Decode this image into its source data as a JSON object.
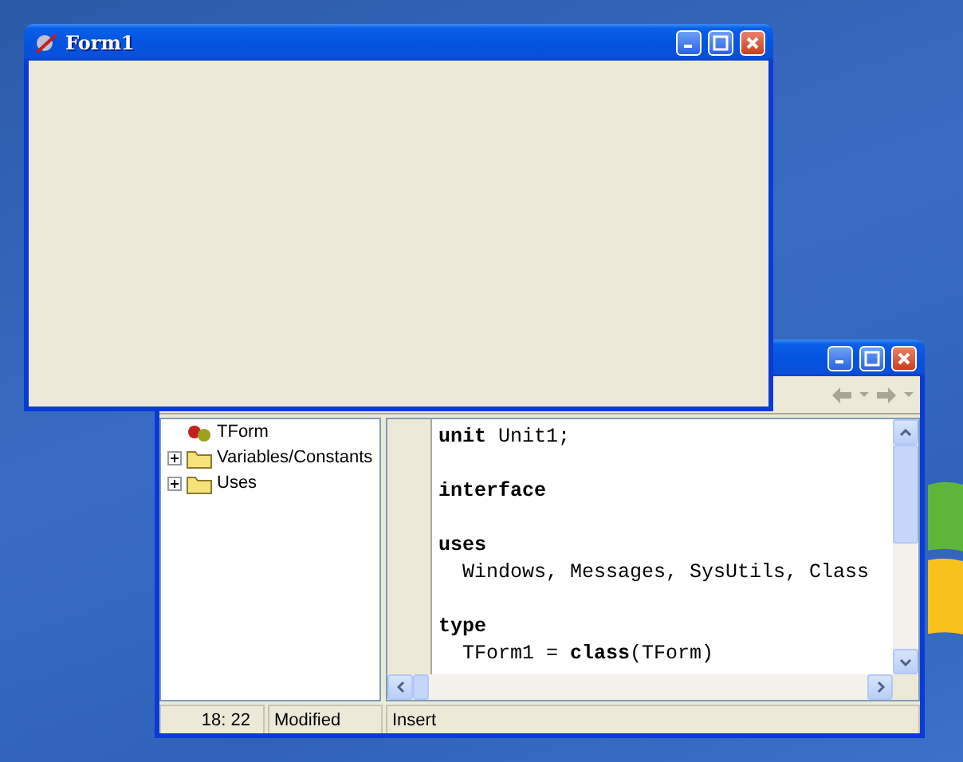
{
  "form_window": {
    "title": "Form1"
  },
  "editor_window": {
    "tree": {
      "items": [
        {
          "label": "TForm",
          "kind": "class",
          "expandable": false
        },
        {
          "label": "Variables/Constants",
          "kind": "folder",
          "expandable": true
        },
        {
          "label": "Uses",
          "kind": "folder",
          "expandable": true
        }
      ]
    },
    "code": {
      "paragraphs": [
        [
          "**unit** Unit1;"
        ],
        [
          "**interface**"
        ],
        [
          "**uses**",
          "  Windows, Messages, SysUtils, Class"
        ],
        [
          "**type**",
          "  TForm1 = **class**(TForm)"
        ]
      ]
    },
    "status_bar": {
      "position": "18: 22",
      "modified": "Modified",
      "mode": "Insert"
    }
  }
}
